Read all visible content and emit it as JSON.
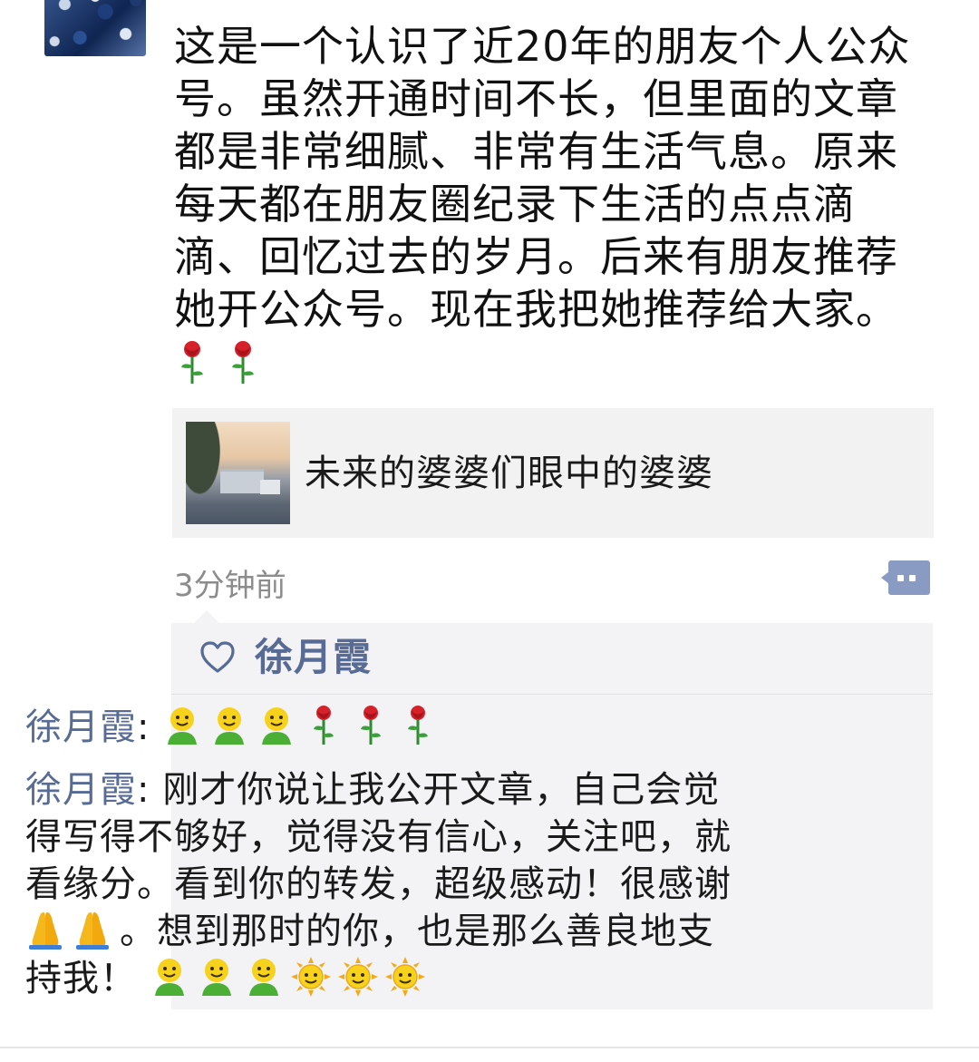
{
  "post": {
    "text": "这是一个认识了近20年的朋友个人公众号。虽然开通时间不长，但里面的文章都是非常细腻、非常有生活气息。原来每天都在朋友圈纪录下生活的点点滴滴、回忆过去的岁月。后来有朋友推荐她开公众号。现在我把她推荐给大家。",
    "trailing_emojis": [
      "rose-emoji",
      "rose-emoji"
    ]
  },
  "link_card": {
    "title": "未来的婆婆们眼中的婆婆"
  },
  "meta": {
    "time": "3分钟前",
    "more_icon": "comment-more-icon"
  },
  "likes": {
    "icon": "heart-icon",
    "names": "徐月霞"
  },
  "comments": [
    {
      "author": "徐月霞",
      "separator": ": ",
      "text": "",
      "emojis": [
        "smile-emoji",
        "smile-emoji",
        "smile-emoji",
        "rose-emoji",
        "rose-emoji",
        "rose-emoji"
      ]
    },
    {
      "author": "徐月霞",
      "separator": ": ",
      "text_before": "刚才你说让我公开文章，自己会觉得写得不够好，觉得没有信心，关注吧，就看缘分。看到你的转发，超级感动！很感谢",
      "mid_emojis": [
        "pray-emoji",
        "pray-emoji"
      ],
      "text_after": "。想到那时的你，也是那么善良地支持我！",
      "end_emojis": [
        "smile-emoji",
        "smile-emoji",
        "smile-emoji",
        "sun-emoji",
        "sun-emoji",
        "sun-emoji"
      ]
    }
  ],
  "colors": {
    "name_blue": "#576b95",
    "comment_bg": "#f3f3f5",
    "card_bg": "#f2f2f2",
    "time_gray": "#8c8c8c"
  }
}
